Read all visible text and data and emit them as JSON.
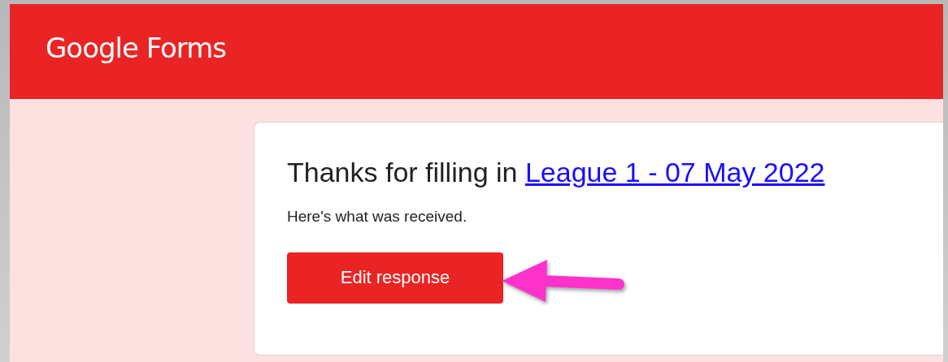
{
  "header": {
    "logo": "Google Forms"
  },
  "card": {
    "heading": "Thanks for filling in ",
    "form_link": "League 1 - 07 May 2022",
    "message": "Here's what was received.",
    "button": "Edit response"
  },
  "annotation": {
    "kind": "arrow"
  }
}
